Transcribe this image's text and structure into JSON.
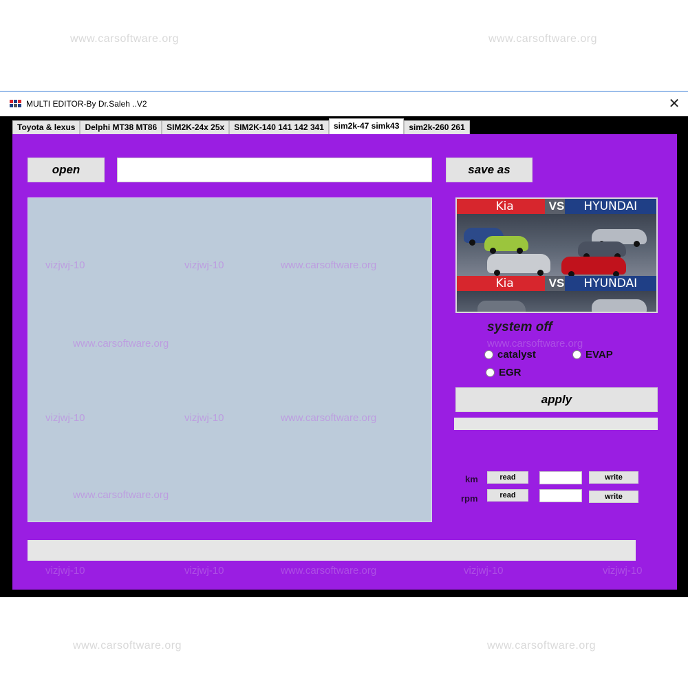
{
  "watermarks": {
    "site": "www.carsoftware.org",
    "user": "vizjwj-10"
  },
  "window": {
    "title": "MULTI EDITOR-By Dr.Saleh ..V2",
    "close_glyph": "✕",
    "icon": "app-logo-icon"
  },
  "tabs": [
    {
      "label": "Toyota & lexus",
      "active": false
    },
    {
      "label": "Delphi MT38 MT86",
      "active": false
    },
    {
      "label": "SIM2K-24x 25x",
      "active": false
    },
    {
      "label": "SIM2K-140 141 142 341",
      "active": false
    },
    {
      "label": "sim2k-47 simk43",
      "active": true
    },
    {
      "label": "sim2k-260 261",
      "active": false
    }
  ],
  "toolbar": {
    "open_label": "open",
    "file_path_value": "",
    "save_as_label": "save as"
  },
  "image": {
    "brand_left": "Kia",
    "vs": "VS",
    "brand_right": "HYUNDAI"
  },
  "system_off": {
    "title": "system off",
    "options": [
      {
        "label": "catalyst",
        "checked": false
      },
      {
        "label": "EVAP",
        "checked": false
      },
      {
        "label": "EGR",
        "checked": false
      }
    ],
    "apply_label": "apply",
    "status_value": ""
  },
  "counters": {
    "km_label": "km",
    "rpm_label": "rpm",
    "read_label": "read",
    "write_label": "write",
    "km_value": "",
    "rpm_value": ""
  },
  "progress": {
    "value": 0
  },
  "colors": {
    "panel": "#9a1ee2",
    "editor": "#bccbda",
    "button": "#e3e3e3",
    "kia_red": "#d7262d",
    "hyundai_blue": "#1f3f86"
  }
}
